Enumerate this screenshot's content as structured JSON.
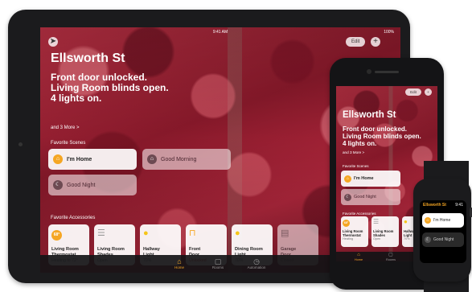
{
  "ipad": {
    "status": {
      "time": "9:41 AM",
      "battery": "100%"
    },
    "top_bar": {
      "add_symbol": "+",
      "edit_label": "Edit"
    },
    "home_name": "Ellsworth St",
    "status_lines": [
      "Front door unlocked.",
      "Living Room blinds open.",
      "4 lights on."
    ],
    "more_link": "and 3 More >",
    "favorite_scenes_label": "Favorite Scenes",
    "scenes": [
      {
        "name": "I'm Home",
        "icon": "person-home-icon",
        "active": true
      },
      {
        "name": "Good Morning",
        "icon": "house-icon",
        "active": false
      },
      {
        "name": "Good Night",
        "icon": "house-moon-icon",
        "active": false
      }
    ],
    "favorite_accessories_label": "Favorite Accessories",
    "accessories": [
      {
        "name_line1": "Living Room",
        "name_line2": "Thermostat",
        "state": "Heating to 72°",
        "badge": "68°",
        "icon": "thermostat-icon",
        "active": true
      },
      {
        "name_line1": "Living Room",
        "name_line2": "Shades",
        "state": "Open",
        "icon": "shades-icon",
        "active": true
      },
      {
        "name_line1": "Hallway",
        "name_line2": "Light",
        "state": "70%",
        "icon": "lightbulb-icon",
        "active": true
      },
      {
        "name_line1": "Front",
        "name_line2": "Door",
        "state": "Unlocked",
        "icon": "lock-open-icon",
        "active": true,
        "alert": true
      },
      {
        "name_line1": "Dining Room",
        "name_line2": "Light",
        "state": "70%",
        "icon": "lightbulb-icon",
        "active": true
      },
      {
        "name_line1": "Garage",
        "name_line2": "Door",
        "state": "Closed",
        "icon": "garage-icon",
        "active": false
      }
    ],
    "tabs": [
      {
        "label": "Home",
        "icon": "home-icon",
        "active": true
      },
      {
        "label": "Rooms",
        "icon": "rooms-icon",
        "active": false
      },
      {
        "label": "Automation",
        "icon": "automation-icon",
        "active": false
      }
    ]
  },
  "iphone": {
    "top_bar": {
      "add_symbol": "+",
      "edit_label": "Edit"
    },
    "home_name": "Ellsworth St",
    "status_lines": [
      "Front door unlocked.",
      "Living Room blinds open.",
      "4 lights on."
    ],
    "more_link": "and 3 More >",
    "favorite_scenes_label": "Favorite Scenes",
    "scenes": [
      {
        "name": "I'm Home",
        "icon": "person-home-icon",
        "active": true
      },
      {
        "name": "Good Night",
        "icon": "house-moon-icon",
        "active": false
      }
    ],
    "favorite_accessories_label": "Favorite Accessories",
    "accessories": [
      {
        "name_line1": "Living Room",
        "name_line2": "Thermostat",
        "state": "Heating",
        "badge": "68°",
        "icon": "thermostat-icon"
      },
      {
        "name_line1": "Living Room",
        "name_line2": "Shades",
        "state": "Open",
        "icon": "shades-icon"
      },
      {
        "name_line1": "Hallway",
        "name_line2": "Light",
        "state": "70%",
        "icon": "lightbulb-icon"
      }
    ],
    "tabs": [
      {
        "label": "Home",
        "icon": "home-icon",
        "active": true
      },
      {
        "label": "Rooms",
        "icon": "rooms-icon",
        "active": false
      }
    ]
  },
  "watch": {
    "title": "Ellsworth St",
    "time": "9:41",
    "scenes": [
      {
        "name": "I'm Home",
        "icon": "person-home-icon",
        "active": true
      },
      {
        "name": "Good Night",
        "icon": "house-moon-icon",
        "active": false
      }
    ]
  },
  "colors": {
    "accent": "#f5a623",
    "foliage": "#a82638",
    "alert": "#d9342b",
    "device_frame": "#1b1b1d"
  }
}
